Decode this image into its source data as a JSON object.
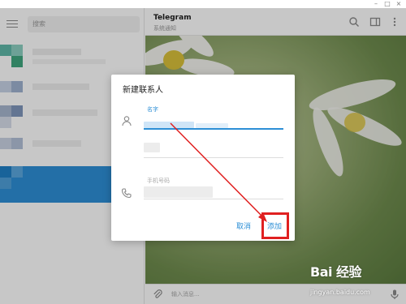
{
  "sidebar": {
    "search_placeholder": "搜索"
  },
  "chat": {
    "title": "Telegram",
    "status": "系统通知",
    "composer_placeholder": "输入消息..."
  },
  "dialog": {
    "title": "新建联系人",
    "name_label": "名字",
    "phone_label": "手机号码",
    "cancel": "取消",
    "add": "添加"
  },
  "watermark": {
    "logo": "Bai 经验",
    "url": "jingyan.baidu.com"
  },
  "colors": {
    "accent": "#2d8fd6",
    "highlight": "#e02020"
  }
}
